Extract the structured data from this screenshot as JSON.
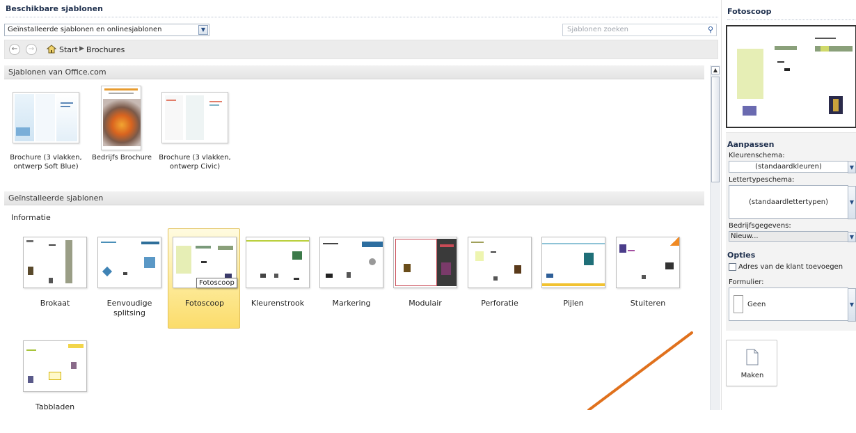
{
  "header": {
    "title": "Beschikbare sjablonen",
    "source_select": "Geïnstalleerde sjablonen en onlinesjablonen",
    "search_placeholder": "Sjablonen zoeken"
  },
  "breadcrumb": {
    "start": "Start",
    "current": "Brochures"
  },
  "office_section": {
    "title": "Sjablonen van Office.com",
    "items": [
      {
        "label": "Brochure (3 vlakken, ontwerp Soft Blue)"
      },
      {
        "label": "Bedrijfs Brochure"
      },
      {
        "label": "Brochure (3 vlakken, ontwerp Civic)"
      }
    ]
  },
  "installed_section": {
    "title": "Geïnstalleerde sjablonen",
    "group": "Informatie",
    "items": [
      {
        "label": "Brokaat"
      },
      {
        "label": "Eenvoudige splitsing"
      },
      {
        "label": "Fotoscoop"
      },
      {
        "label": "Kleurenstrook"
      },
      {
        "label": "Markering"
      },
      {
        "label": "Modulair"
      },
      {
        "label": "Perforatie"
      },
      {
        "label": "Pijlen"
      },
      {
        "label": "Stuiteren"
      },
      {
        "label": "Tabbladen"
      }
    ],
    "selected_tooltip": "Fotoscoop"
  },
  "right_panel": {
    "title": "Fotoscoop",
    "customize_heading": "Aanpassen",
    "color_scheme_label": "Kleurenschema:",
    "color_scheme_value": "(standaardkleuren)",
    "font_scheme_label": "Lettertypeschema:",
    "font_scheme_value": "(standaardlettertypen)",
    "business_info_label": "Bedrijfsgegevens:",
    "business_info_value": "Nieuw...",
    "options_heading": "Opties",
    "customer_address_label": "Adres van de klant toevoegen",
    "form_label": "Formulier:",
    "form_value": "Geen",
    "make_button": "Maken"
  },
  "colors": {
    "selected_tile": "#fde995",
    "arrow": "#e0711d",
    "title_text": "#1e2f4d"
  }
}
